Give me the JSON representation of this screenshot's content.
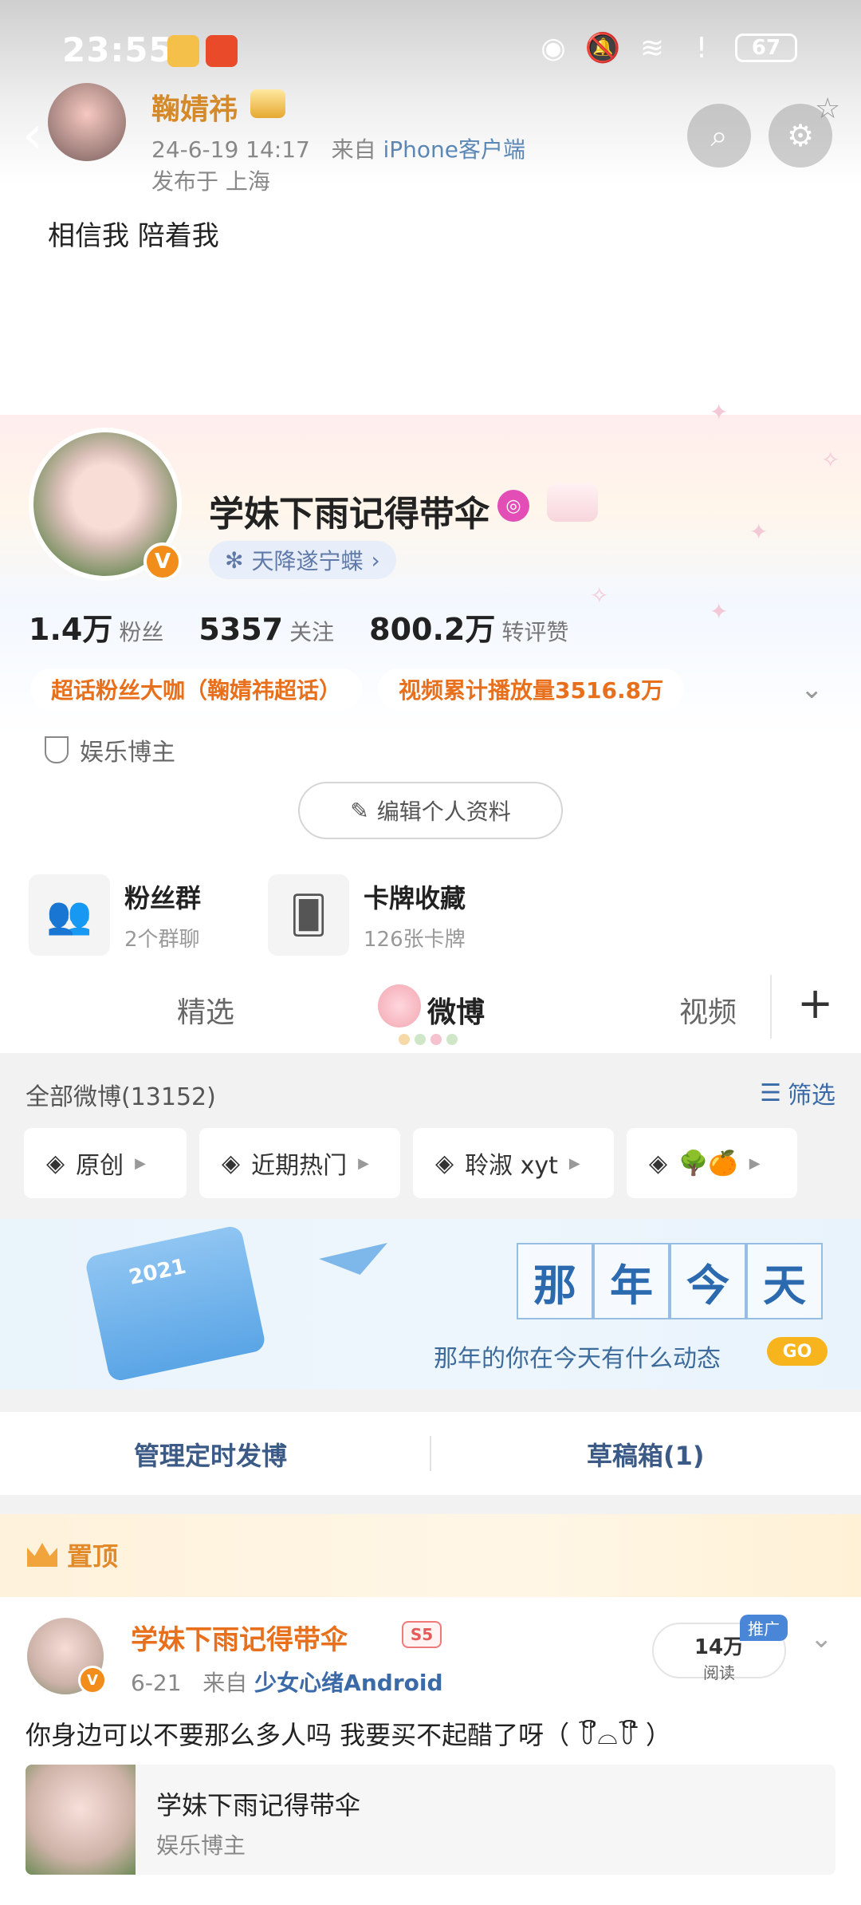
{
  "status_bar": {
    "time": "23:55",
    "battery": "67"
  },
  "post_header": {
    "author": "鞠婧祎",
    "time": "24-6-19 14:17",
    "from_prefix": "来自",
    "source": "iPhone客户端",
    "location": "发布于 上海",
    "text": "相信我 陪着我"
  },
  "profile": {
    "nickname": "学妹下雨记得带伞",
    "title_chip": "天降遂宁蝶",
    "stats": [
      {
        "num": "1.4万",
        "label": "粉丝"
      },
      {
        "num": "5357",
        "label": "关注"
      },
      {
        "num": "800.2万",
        "label": "转评赞"
      }
    ],
    "tags": [
      "超话粉丝大咖（鞠婧祎超话）",
      "视频累计播放量3516.8万"
    ],
    "role": "娱乐博主",
    "edit_button": "编辑个人资料"
  },
  "features": [
    {
      "title": "粉丝群",
      "subtitle": "2个群聊"
    },
    {
      "title": "卡牌收藏",
      "subtitle": "126张卡牌"
    }
  ],
  "tabs": {
    "featured": "精选",
    "weibo": "微博",
    "video": "视频"
  },
  "feed": {
    "all_count": "全部微博(13152)",
    "filter": "筛选",
    "chips": [
      "原创",
      "近期热门",
      "聆淑 xyt",
      "🌳🍊"
    ]
  },
  "banner": {
    "title_chars": [
      "那",
      "年",
      "今",
      "天"
    ],
    "subtitle": "那年的你在今天有什么动态",
    "go": "GO",
    "calendar_year": "2021"
  },
  "manage": {
    "scheduled": "管理定时发博",
    "drafts": "草稿箱(1)"
  },
  "pinned": {
    "label": "置顶",
    "name": "学妹下雨记得带伞",
    "level": "S5",
    "date": "6-21",
    "from_prefix": "来自",
    "device": "少女心绪Android",
    "reads_num": "14万",
    "reads_label": "阅读",
    "promo": "推广",
    "text": "你身边可以不要那么多人吗 我要买不起醋了呀（ ꒦ິ⌓꒦ີ ）",
    "card_title": "学妹下雨记得带伞",
    "card_subtitle": "娱乐博主"
  },
  "colors": {
    "accent_orange": "#e86f1c",
    "link_blue": "#3a6aa8",
    "verified": "#f28c1a"
  }
}
